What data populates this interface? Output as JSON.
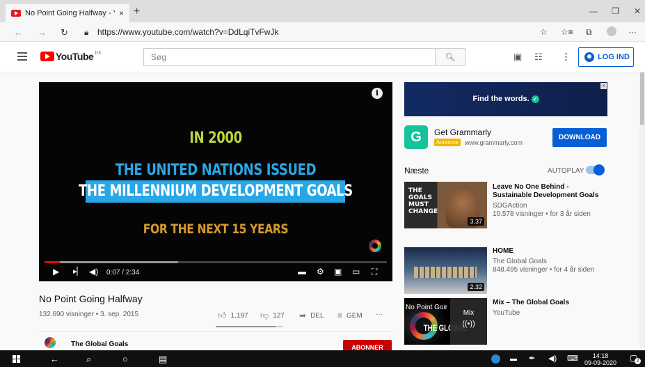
{
  "browser": {
    "tab_title": "No Point Going Halfway - YouTu",
    "tab_close": "×",
    "new_tab": "+",
    "url": "https://www.youtube.com/watch?v=DdLqiTvFwJk",
    "window_controls": {
      "minimize": "—",
      "restore": "❐",
      "close": "✕"
    },
    "nav": {
      "back": "←",
      "forward": "→",
      "refresh": "↻",
      "lock": "🔒"
    },
    "toolbar": {
      "favorite": "☆",
      "favorites": "☆≡",
      "collections": "⧉",
      "more": "···"
    }
  },
  "youtube_header": {
    "logo_text": "YouTube",
    "country_code": "DK",
    "search_placeholder": "Søg",
    "search_icon": "⚲",
    "login_label": "LOG IND",
    "icons": [
      "video-camera-icon",
      "apps-grid-icon",
      "more-vert-icon"
    ]
  },
  "player": {
    "lines": [
      "IN 2000",
      "THE UNITED NATIONS ISSUED",
      "THE MILLENNIUM DEVELOPMENT GOALS",
      "FOR THE NEXT 15 YEARS"
    ],
    "info_icon": "i",
    "time": "0:07 / 2:34",
    "progress_fraction": 0.045,
    "buffered_fraction": 0.39,
    "colors": {
      "line1": "#bcd63c",
      "line2": "#27a7e6",
      "line3_bg": "#27a7e6",
      "line4": "#d49b2a"
    }
  },
  "video": {
    "title": "No Point Going Halfway",
    "meta": "132.690 visninger • 3. sep. 2015",
    "likes": "1.197",
    "dislikes": "127",
    "share_label": "DEL",
    "save_label": "GEM",
    "more": "···",
    "like_fraction": 0.9,
    "channel_name": "The Global Goals",
    "subscribe_label": "ABONNER"
  },
  "ad": {
    "banner_text": "Find the words.",
    "logo_letter": "G",
    "name": "Get Grammarly",
    "tag": "Annonce",
    "domain": "www.grammarly.com",
    "cta": "DOWNLOAD",
    "close": "x"
  },
  "up_next": {
    "label": "Næste",
    "autoplay_label": "AUTOPLAY",
    "autoplay_on": true
  },
  "recommendations": [
    {
      "title": "Leave No One Behind - Sustainable Development Goals",
      "channel": "SDGAction",
      "stats": "10.578 visninger • for 3 år siden",
      "duration": "3.37",
      "thumb_text": "THE\nGOALS\nMUST\nCHANGE"
    },
    {
      "title": "HOME",
      "channel": "The Global Goals",
      "stats": "848.495 visninger • for 4 år siden",
      "duration": "2.32"
    },
    {
      "title": "Mix – The Global Goals",
      "channel": "YouTube",
      "thumb_label": "No Point Goir",
      "thumb_big": "THE GLOBAL",
      "mix_label": "Mix",
      "mix_icon": "((•))"
    }
  ],
  "taskbar": {
    "time": "14:18",
    "date": "09-09-2020",
    "notification_count": "2"
  }
}
